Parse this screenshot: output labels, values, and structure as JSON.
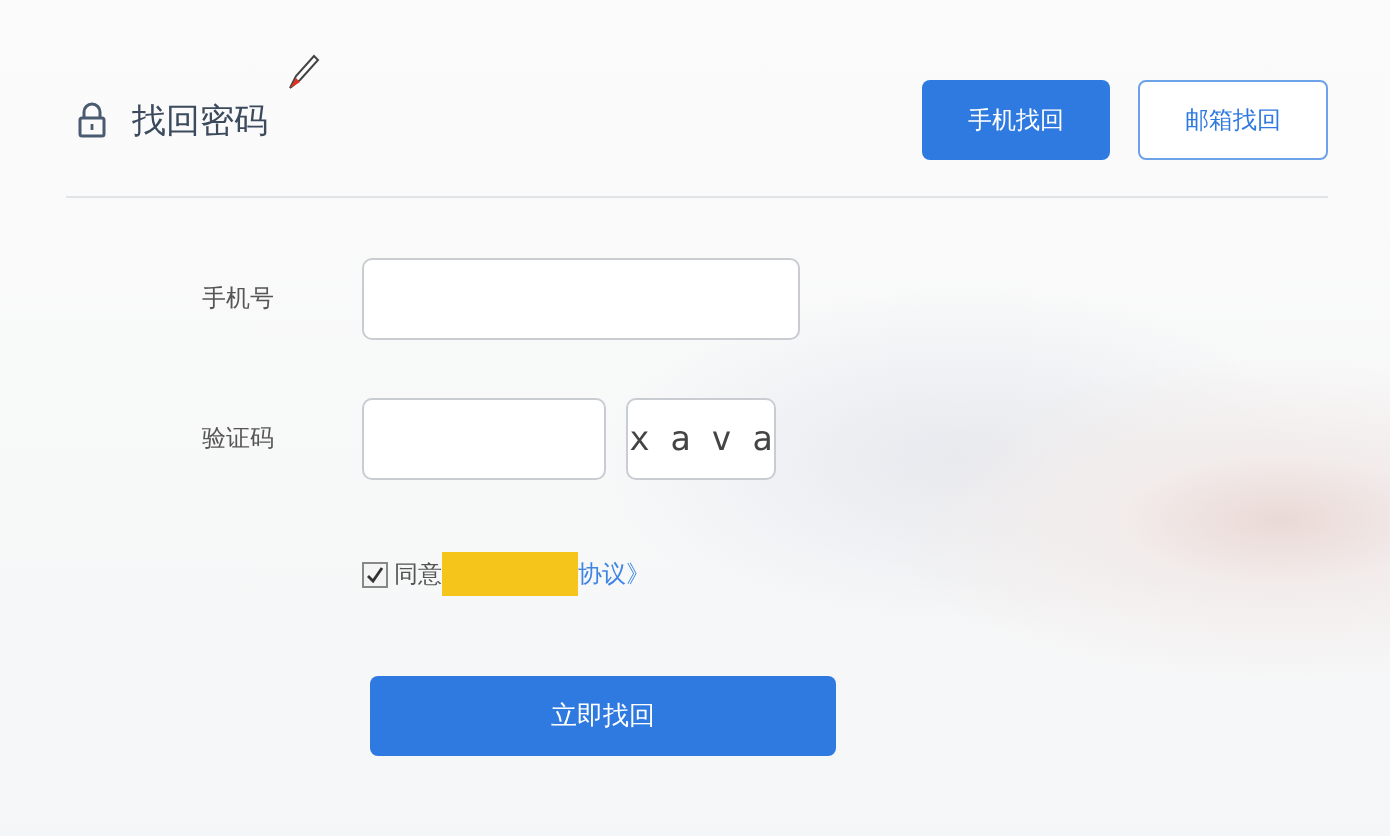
{
  "header": {
    "title": "找回密码",
    "buttons": [
      {
        "label": "手机找回",
        "selected": true
      },
      {
        "label": "邮箱找回",
        "selected": false
      }
    ]
  },
  "form": {
    "fields": [
      {
        "label": "手机号",
        "kind": "text"
      },
      {
        "label": "验证码",
        "kind": "captcha",
        "captcha": "x a v a"
      }
    ],
    "agreement": {
      "checked": true,
      "text": "同意",
      "link": "协议》",
      "redacted": true
    },
    "submit": "立即找回"
  }
}
